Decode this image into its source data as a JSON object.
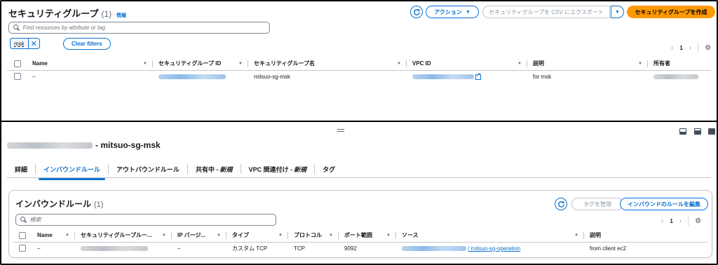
{
  "top_panel": {
    "title": "セキュリティグループ",
    "count": "(1)",
    "info_link": "情報",
    "actions_label": "アクション",
    "actions_caret": "▼",
    "export_label": "セキュリティグループを CSV にエクスポート",
    "export_caret": "▼",
    "create_label": "セキュリティグループを作成",
    "search_placeholder": "Find resources by attribute or tag",
    "filter_token": "msk",
    "filter_remove": "✕",
    "clear_filters_label": "Clear filters",
    "pagination": {
      "prev": "‹",
      "page": "1",
      "next": "›"
    },
    "table": {
      "columns": [
        "Name",
        "セキュリティグループ ID",
        "セキュリティグループ名",
        "VPC ID",
        "説明",
        "所有者"
      ],
      "sort_glyph": "▼",
      "rows": [
        {
          "name": "–",
          "sg_name": "mitsuo-sg-msk",
          "description": "for msk"
        }
      ]
    }
  },
  "detail": {
    "title_suffix": "- mitsuo-sg-msk",
    "tabs": [
      {
        "label": "詳細"
      },
      {
        "label": "インバウンドルール"
      },
      {
        "label": "アウトバウンドルール"
      },
      {
        "label": "共有中 -",
        "tag": "新規"
      },
      {
        "label": "VPC 関連付け -",
        "tag": "新規"
      },
      {
        "label": "タグ"
      }
    ],
    "inbound": {
      "title": "インバウンドルール",
      "count": "(1)",
      "manage_tags_label": "タグを管理",
      "edit_rules_label": "インバウンドのルールを編集",
      "search_placeholder": "検索",
      "pagination": {
        "prev": "‹",
        "page": "1",
        "next": "›"
      },
      "columns": [
        "Name",
        "セキュリティグループルー...",
        "IP バージ...",
        "タイプ",
        "プロトコル",
        "ポート範囲",
        "ソース",
        "説明"
      ],
      "sort_glyph": "▼",
      "rows": [
        {
          "name": "–",
          "ip_version": "–",
          "type": "カスタム TCP",
          "protocol": "TCP",
          "port_range": "9092",
          "source_suffix": "/ mitsuo-sg-operation",
          "description": "from client ec2"
        }
      ]
    }
  },
  "colors": {
    "accent": "#0972d3",
    "primary_button": "#ff9900",
    "text": "#16191f"
  },
  "icons": [
    "refresh-icon",
    "search-icon",
    "settings-icon",
    "external-link-icon",
    "split-handle-icon",
    "layout-icon"
  ]
}
